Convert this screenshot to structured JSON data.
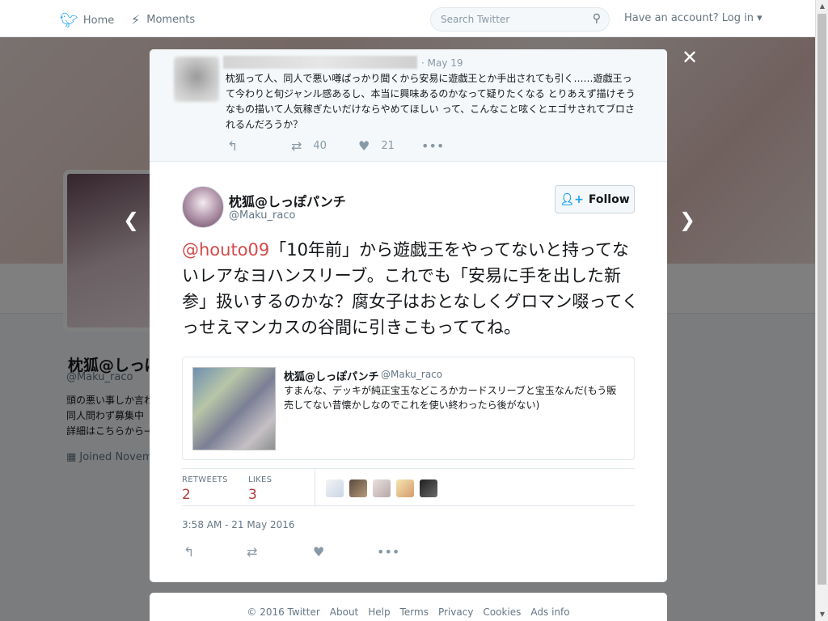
{
  "nav": {
    "home": "Home",
    "moments": "Moments",
    "search_placeholder": "Search Twitter",
    "login": "Have an account? Log in"
  },
  "profile": {
    "name": "枕狐@しっぽ",
    "handle": "@Maku_raco",
    "bio_lines": [
      "頭の悪い事しか言わ",
      "同人問わず募集中",
      "詳細はこちらから→"
    ],
    "joined": "Joined Novem"
  },
  "ancestor": {
    "date": "· May 19",
    "text": "枕狐って人、同人で悪い噂ぱっかり聞くから安易に遊戯王とか手出されても引く……遊戯王って今わりと旬ジャンル感あるし、本当に興味あるのかなって疑りたくなる とりあえず描けそうなもの描いて人気稼ぎたいだけならやめてほしい って、こんなこと呟くとエゴサされてブロされるんだろうか？",
    "retweets": "40",
    "likes": "21"
  },
  "tweet": {
    "name": "枕狐@しっぽパンチ",
    "handle": "@Maku_raco",
    "follow_label": "Follow",
    "mention": "@houto09",
    "text": "「10年前」から遊戯王をやってないと持ってないレアなヨハンスリーブ。これでも「安易に手を出した新参」扱いするのかな？腐女子はおとなしくグロマン啜ってくっせえマンカスの谷間に引きこもっててね。",
    "quote": {
      "name": "枕狐@しっぽパンチ",
      "handle": "@Maku_raco",
      "text": "すまんな、デッキが純正宝玉などころかカードスリーブと宝玉なんだ(もう販売してない昔懐かしなのでこれを使い終わったら後がない)"
    },
    "stats": {
      "retweets_label": "RETWEETS",
      "retweets": "2",
      "likes_label": "LIKES",
      "likes": "3"
    },
    "timestamp": "3:58 AM - 21 May 2016"
  },
  "footer": {
    "links": [
      "© 2016 Twitter",
      "About",
      "Help",
      "Terms",
      "Privacy",
      "Cookies",
      "Ads info"
    ]
  },
  "colors": {
    "accent": "#1da1f2",
    "mention": "#d34a4a",
    "stat_value": "#b03b3b"
  },
  "icons": {
    "home": "twitter-bird-icon",
    "moments": "lightning-icon",
    "search": "search-icon",
    "close": "close-icon",
    "reply": "reply-icon",
    "retweet": "retweet-icon",
    "like": "heart-icon",
    "more": "more-icon",
    "follow": "add-user-icon"
  }
}
